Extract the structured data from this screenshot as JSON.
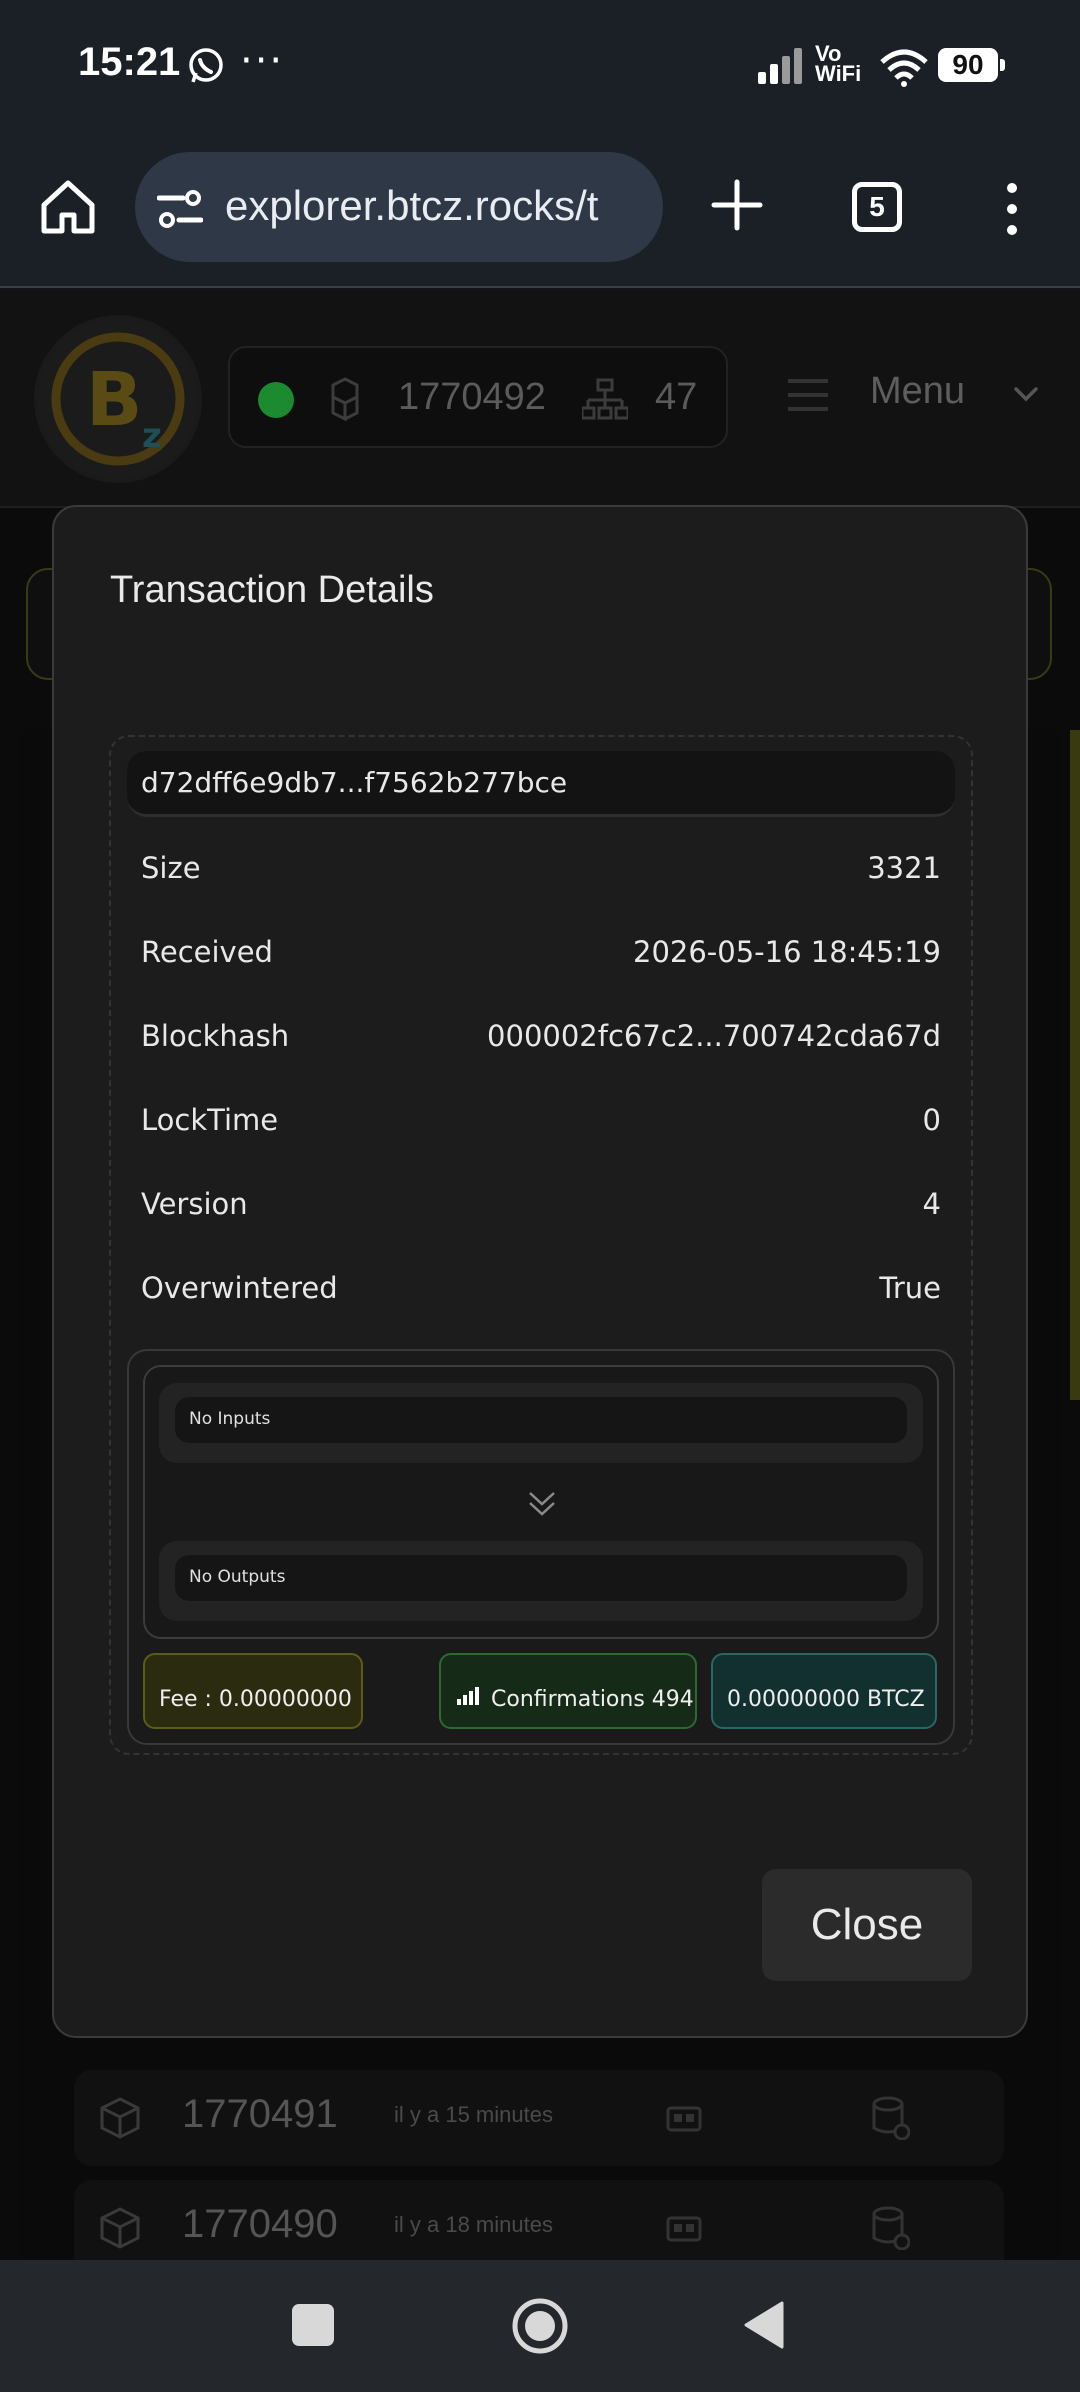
{
  "status_bar": {
    "time": "15:21",
    "dots": "···",
    "vowifi": "Vo\nWiFi",
    "battery": "90"
  },
  "browser": {
    "url": "explorer.btcz.rocks/t",
    "tab_count": "5"
  },
  "site": {
    "block_height": "1770492",
    "peers": "47",
    "menu_label": "Menu",
    "blocks": [
      {
        "height": "1770491",
        "time": "il y a 15 minutes"
      },
      {
        "height": "1770490",
        "time": "il y a 18 minutes"
      }
    ]
  },
  "modal": {
    "title": "Transaction Details",
    "txid": "d72dff6e9db7...f7562b277bce",
    "fields": [
      {
        "label": "Size",
        "value": "3321"
      },
      {
        "label": "Received",
        "value": "2026-05-16 18:45:19"
      },
      {
        "label": "Blockhash",
        "value": "000002fc67c2...700742cda67d"
      },
      {
        "label": "LockTime",
        "value": "0"
      },
      {
        "label": "Version",
        "value": "4"
      },
      {
        "label": "Overwintered",
        "value": "True"
      }
    ],
    "inputs_text": "No Inputs",
    "outputs_text": "No Outputs",
    "fee": "Fee : 0.00000000",
    "confirmations": "Confirmations 494",
    "amount": "0.00000000 BTCZ",
    "close_label": "Close"
  },
  "colors": {
    "online": "#1c8a2e",
    "fee_badge": "#2b2b10",
    "confirm_badge": "#152b18",
    "amount_badge": "#12302f"
  }
}
